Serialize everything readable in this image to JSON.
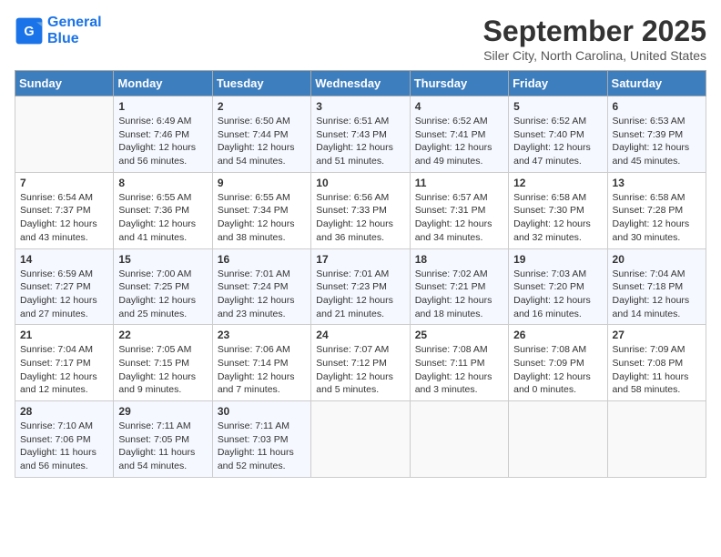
{
  "header": {
    "logo_line1": "General",
    "logo_line2": "Blue",
    "month": "September 2025",
    "location": "Siler City, North Carolina, United States"
  },
  "weekdays": [
    "Sunday",
    "Monday",
    "Tuesday",
    "Wednesday",
    "Thursday",
    "Friday",
    "Saturday"
  ],
  "weeks": [
    [
      {
        "num": "",
        "sunrise": "",
        "sunset": "",
        "daylight": ""
      },
      {
        "num": "1",
        "sunrise": "Sunrise: 6:49 AM",
        "sunset": "Sunset: 7:46 PM",
        "daylight": "Daylight: 12 hours and 56 minutes."
      },
      {
        "num": "2",
        "sunrise": "Sunrise: 6:50 AM",
        "sunset": "Sunset: 7:44 PM",
        "daylight": "Daylight: 12 hours and 54 minutes."
      },
      {
        "num": "3",
        "sunrise": "Sunrise: 6:51 AM",
        "sunset": "Sunset: 7:43 PM",
        "daylight": "Daylight: 12 hours and 51 minutes."
      },
      {
        "num": "4",
        "sunrise": "Sunrise: 6:52 AM",
        "sunset": "Sunset: 7:41 PM",
        "daylight": "Daylight: 12 hours and 49 minutes."
      },
      {
        "num": "5",
        "sunrise": "Sunrise: 6:52 AM",
        "sunset": "Sunset: 7:40 PM",
        "daylight": "Daylight: 12 hours and 47 minutes."
      },
      {
        "num": "6",
        "sunrise": "Sunrise: 6:53 AM",
        "sunset": "Sunset: 7:39 PM",
        "daylight": "Daylight: 12 hours and 45 minutes."
      }
    ],
    [
      {
        "num": "7",
        "sunrise": "Sunrise: 6:54 AM",
        "sunset": "Sunset: 7:37 PM",
        "daylight": "Daylight: 12 hours and 43 minutes."
      },
      {
        "num": "8",
        "sunrise": "Sunrise: 6:55 AM",
        "sunset": "Sunset: 7:36 PM",
        "daylight": "Daylight: 12 hours and 41 minutes."
      },
      {
        "num": "9",
        "sunrise": "Sunrise: 6:55 AM",
        "sunset": "Sunset: 7:34 PM",
        "daylight": "Daylight: 12 hours and 38 minutes."
      },
      {
        "num": "10",
        "sunrise": "Sunrise: 6:56 AM",
        "sunset": "Sunset: 7:33 PM",
        "daylight": "Daylight: 12 hours and 36 minutes."
      },
      {
        "num": "11",
        "sunrise": "Sunrise: 6:57 AM",
        "sunset": "Sunset: 7:31 PM",
        "daylight": "Daylight: 12 hours and 34 minutes."
      },
      {
        "num": "12",
        "sunrise": "Sunrise: 6:58 AM",
        "sunset": "Sunset: 7:30 PM",
        "daylight": "Daylight: 12 hours and 32 minutes."
      },
      {
        "num": "13",
        "sunrise": "Sunrise: 6:58 AM",
        "sunset": "Sunset: 7:28 PM",
        "daylight": "Daylight: 12 hours and 30 minutes."
      }
    ],
    [
      {
        "num": "14",
        "sunrise": "Sunrise: 6:59 AM",
        "sunset": "Sunset: 7:27 PM",
        "daylight": "Daylight: 12 hours and 27 minutes."
      },
      {
        "num": "15",
        "sunrise": "Sunrise: 7:00 AM",
        "sunset": "Sunset: 7:25 PM",
        "daylight": "Daylight: 12 hours and 25 minutes."
      },
      {
        "num": "16",
        "sunrise": "Sunrise: 7:01 AM",
        "sunset": "Sunset: 7:24 PM",
        "daylight": "Daylight: 12 hours and 23 minutes."
      },
      {
        "num": "17",
        "sunrise": "Sunrise: 7:01 AM",
        "sunset": "Sunset: 7:23 PM",
        "daylight": "Daylight: 12 hours and 21 minutes."
      },
      {
        "num": "18",
        "sunrise": "Sunrise: 7:02 AM",
        "sunset": "Sunset: 7:21 PM",
        "daylight": "Daylight: 12 hours and 18 minutes."
      },
      {
        "num": "19",
        "sunrise": "Sunrise: 7:03 AM",
        "sunset": "Sunset: 7:20 PM",
        "daylight": "Daylight: 12 hours and 16 minutes."
      },
      {
        "num": "20",
        "sunrise": "Sunrise: 7:04 AM",
        "sunset": "Sunset: 7:18 PM",
        "daylight": "Daylight: 12 hours and 14 minutes."
      }
    ],
    [
      {
        "num": "21",
        "sunrise": "Sunrise: 7:04 AM",
        "sunset": "Sunset: 7:17 PM",
        "daylight": "Daylight: 12 hours and 12 minutes."
      },
      {
        "num": "22",
        "sunrise": "Sunrise: 7:05 AM",
        "sunset": "Sunset: 7:15 PM",
        "daylight": "Daylight: 12 hours and 9 minutes."
      },
      {
        "num": "23",
        "sunrise": "Sunrise: 7:06 AM",
        "sunset": "Sunset: 7:14 PM",
        "daylight": "Daylight: 12 hours and 7 minutes."
      },
      {
        "num": "24",
        "sunrise": "Sunrise: 7:07 AM",
        "sunset": "Sunset: 7:12 PM",
        "daylight": "Daylight: 12 hours and 5 minutes."
      },
      {
        "num": "25",
        "sunrise": "Sunrise: 7:08 AM",
        "sunset": "Sunset: 7:11 PM",
        "daylight": "Daylight: 12 hours and 3 minutes."
      },
      {
        "num": "26",
        "sunrise": "Sunrise: 7:08 AM",
        "sunset": "Sunset: 7:09 PM",
        "daylight": "Daylight: 12 hours and 0 minutes."
      },
      {
        "num": "27",
        "sunrise": "Sunrise: 7:09 AM",
        "sunset": "Sunset: 7:08 PM",
        "daylight": "Daylight: 11 hours and 58 minutes."
      }
    ],
    [
      {
        "num": "28",
        "sunrise": "Sunrise: 7:10 AM",
        "sunset": "Sunset: 7:06 PM",
        "daylight": "Daylight: 11 hours and 56 minutes."
      },
      {
        "num": "29",
        "sunrise": "Sunrise: 7:11 AM",
        "sunset": "Sunset: 7:05 PM",
        "daylight": "Daylight: 11 hours and 54 minutes."
      },
      {
        "num": "30",
        "sunrise": "Sunrise: 7:11 AM",
        "sunset": "Sunset: 7:03 PM",
        "daylight": "Daylight: 11 hours and 52 minutes."
      },
      {
        "num": "",
        "sunrise": "",
        "sunset": "",
        "daylight": ""
      },
      {
        "num": "",
        "sunrise": "",
        "sunset": "",
        "daylight": ""
      },
      {
        "num": "",
        "sunrise": "",
        "sunset": "",
        "daylight": ""
      },
      {
        "num": "",
        "sunrise": "",
        "sunset": "",
        "daylight": ""
      }
    ]
  ]
}
